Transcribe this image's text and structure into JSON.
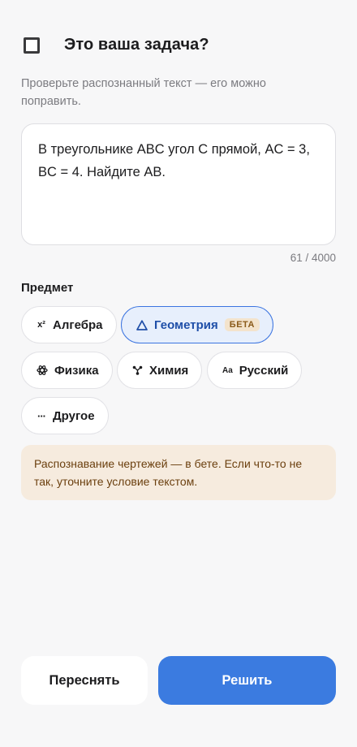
{
  "header": {
    "title": "Это ваша задача?",
    "subtitle": "Проверьте распознанный текст — его можно поправить."
  },
  "problem": {
    "text": "В треугольнике ABC угол C прямой, AC = 3, BC = 4. Найдите AB.",
    "counter": "61 / 4000"
  },
  "subject": {
    "label": "Предмет",
    "selected": "Геометрия",
    "chips": [
      {
        "label": "Алгебра",
        "icon": "x²"
      },
      {
        "label": "Геометрия",
        "icon": "△",
        "badge": "БЕТА"
      },
      {
        "label": "Физика",
        "icon": "atom-icon"
      },
      {
        "label": "Химия",
        "icon": "molecule-icon"
      },
      {
        "label": "Русский",
        "icon": "Aa"
      },
      {
        "label": "Другое",
        "icon": "···"
      }
    ]
  },
  "notice": "Распознавание чертежей — в бете. Если что-то не так, уточните условие текстом.",
  "actions": {
    "retake": "Переснять",
    "solve": "Решить"
  },
  "colors": {
    "accent": "#3b7be0",
    "notice_bg": "#f6ebde",
    "beta_bg": "#f3e3cc"
  }
}
